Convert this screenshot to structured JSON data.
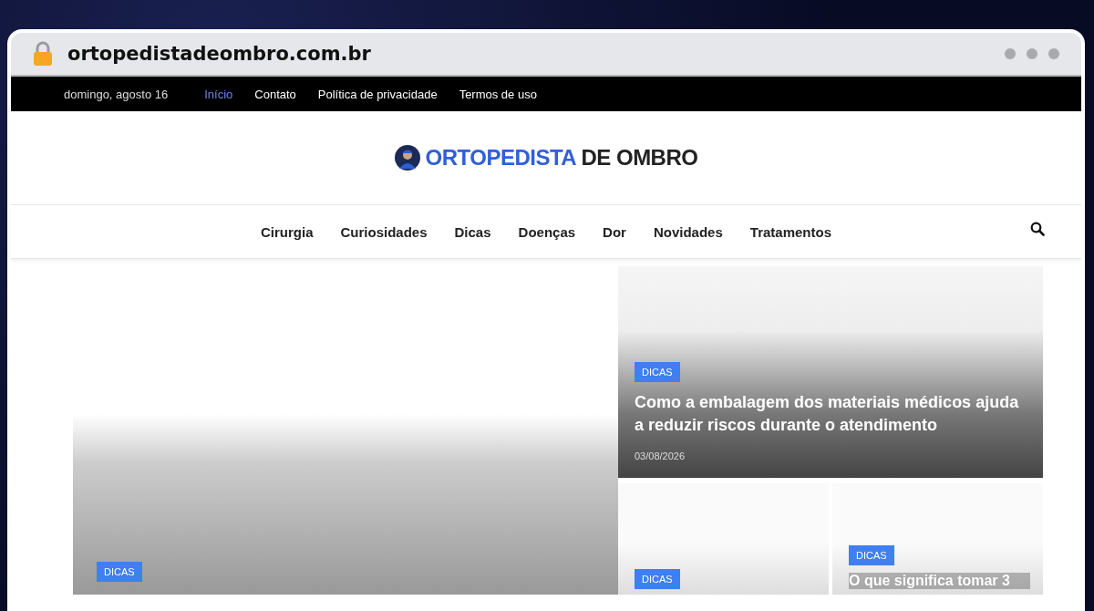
{
  "browser": {
    "url": "ortopedistadeombro.com.br"
  },
  "top_bar": {
    "date": "domingo, agosto 16",
    "links": [
      {
        "label": "Início",
        "selected": true
      },
      {
        "label": "Contato",
        "selected": false
      },
      {
        "label": "Política de privacidade",
        "selected": false
      },
      {
        "label": "Termos de uso",
        "selected": false
      }
    ]
  },
  "logo": {
    "part_1": "ORTOPEDISTA",
    "part_2": "DE OMBRO"
  },
  "nav": {
    "items": [
      "Cirurgia",
      "Curiosidades",
      "Dicas",
      "Doenças",
      "Dor",
      "Novidades",
      "Tratamentos"
    ]
  },
  "posts": [
    {
      "kind": "large",
      "category": "DICAS"
    },
    {
      "kind": "feature",
      "category": "DICAS",
      "title": "Como a embalagem dos materiais médicos ajuda a reduzir riscos durante o atendimento",
      "date": "03/08/2026"
    },
    {
      "kind": "small",
      "category": "DICAS"
    },
    {
      "kind": "small",
      "category": "DICAS",
      "title": "O que significa tomar 3"
    }
  ]
}
